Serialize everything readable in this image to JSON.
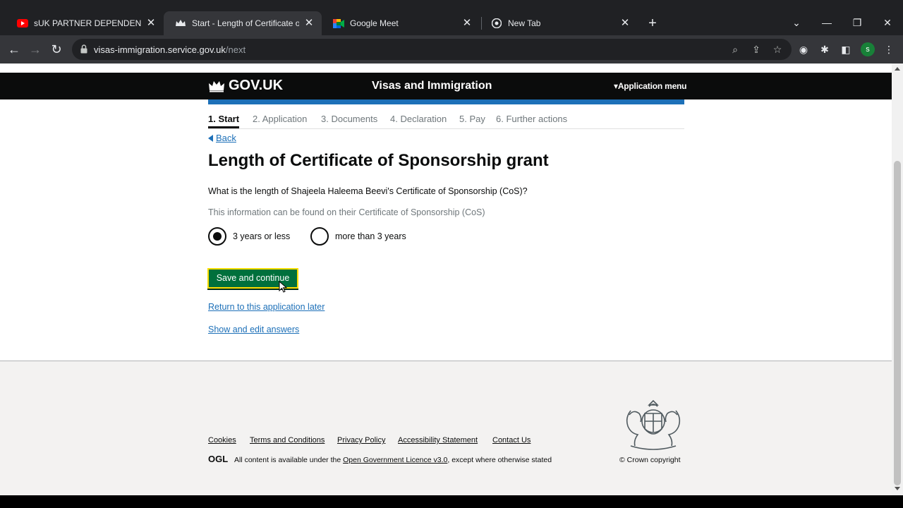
{
  "browser": {
    "tabs": [
      {
        "title": "sUK PARTNER DEPENDENT VISA",
        "favicon": "youtube-icon",
        "active": false
      },
      {
        "title": "Start - Length of Certificate of Sp",
        "favicon": "crown-icon",
        "active": true
      },
      {
        "title": "Google Meet",
        "favicon": "google-meet-icon",
        "active": false
      },
      {
        "title": "New Tab",
        "favicon": "chrome-icon",
        "active": false
      }
    ],
    "url_host": "visas-immigration.service.gov.uk",
    "url_path": "/next",
    "profile_initial": "s"
  },
  "header": {
    "logo_text": "GOV.UK",
    "service_name": "Visas and Immigration",
    "menu_label": "Application menu"
  },
  "steps": [
    "1. Start",
    "2. Application",
    "3. Documents",
    "4. Declaration",
    "5. Pay",
    "6. Further actions"
  ],
  "main": {
    "back_label": "Back",
    "title": "Length of Certificate of Sponsorship grant",
    "question": "What is the length of Shajeela Haleema Beevi's Certificate of Sponsorship (CoS)?",
    "hint": "This information can be found on their Certificate of Sponsorship (CoS)",
    "options": [
      {
        "label": "3 years or less",
        "selected": true
      },
      {
        "label": "more than 3 years",
        "selected": false
      }
    ],
    "save_button": "Save and continue",
    "return_link": "Return to this application later",
    "show_edit_link": "Show and edit answers"
  },
  "footer": {
    "links": [
      "Cookies",
      "Terms and Conditions",
      "Privacy Policy",
      "Accessibility Statement",
      "Contact Us"
    ],
    "ogl": "OGL",
    "licence_prefix": "All content is available under the",
    "licence_link": "Open Government Licence v3.0",
    "licence_suffix": ", except where otherwise stated",
    "copyright": "© Crown copyright"
  },
  "colors": {
    "govuk_black": "#0b0c0c",
    "govuk_blue": "#1d70b8",
    "button_green": "#00703c",
    "focus_yellow": "#ffdd00"
  }
}
